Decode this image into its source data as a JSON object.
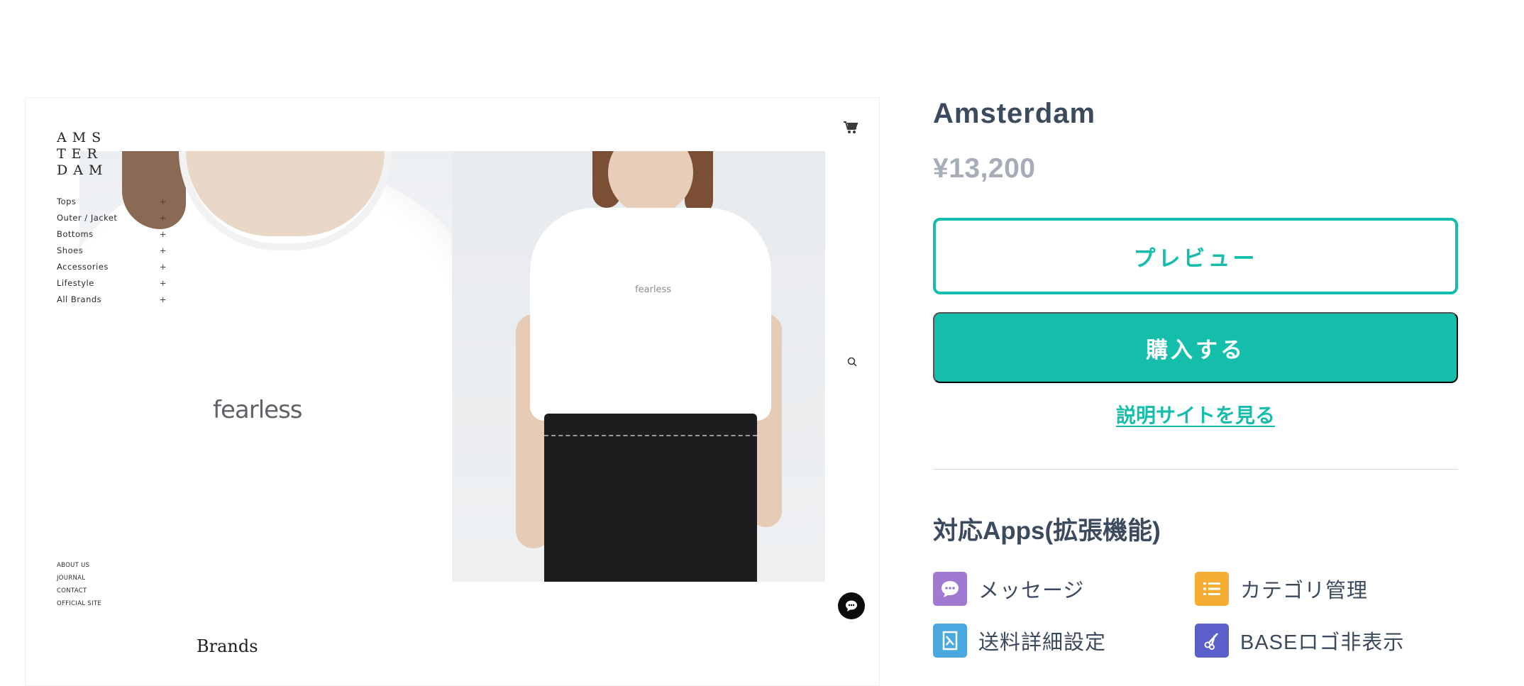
{
  "preview": {
    "brand_logo": "AMS\nTER\nDAM",
    "nav": [
      {
        "label": "Tops",
        "symbol": "+"
      },
      {
        "label": "Outer / Jacket",
        "symbol": "+"
      },
      {
        "label": "Bottoms",
        "symbol": "+"
      },
      {
        "label": "Shoes",
        "symbol": "+"
      },
      {
        "label": "Accessories",
        "symbol": "+"
      },
      {
        "label": "Lifestyle",
        "symbol": "+"
      },
      {
        "label": "All Brands",
        "symbol": "+"
      }
    ],
    "footer_links": [
      "ABOUT US",
      "JOURNAL",
      "CONTACT",
      "OFFICIAL SITE"
    ],
    "print_text_large": "fearless",
    "print_text_small": "fearless",
    "brands_heading": "Brands",
    "icons": {
      "cart": "cart-icon",
      "zoom": "magnifier-icon",
      "chat": "chat-bubble-icon"
    }
  },
  "product": {
    "title": "Amsterdam",
    "price": "¥13,200",
    "preview_button": "プレビュー",
    "buy_button": "購入する",
    "description_link": "説明サイトを見る",
    "accent_color": "#14beaa"
  },
  "apps": {
    "heading": "対応Apps(拡張機能)",
    "items": [
      {
        "label": "メッセージ",
        "icon": "message-icon",
        "color": "#a07ad0"
      },
      {
        "label": "カテゴリ管理",
        "icon": "list-icon",
        "color": "#f6ad33"
      },
      {
        "label": "送料詳細設定",
        "icon": "shipping-icon",
        "color": "#4aa8e0"
      },
      {
        "label": "BASEロゴ非表示",
        "icon": "scissors-icon",
        "color": "#5a5fc9"
      }
    ]
  }
}
